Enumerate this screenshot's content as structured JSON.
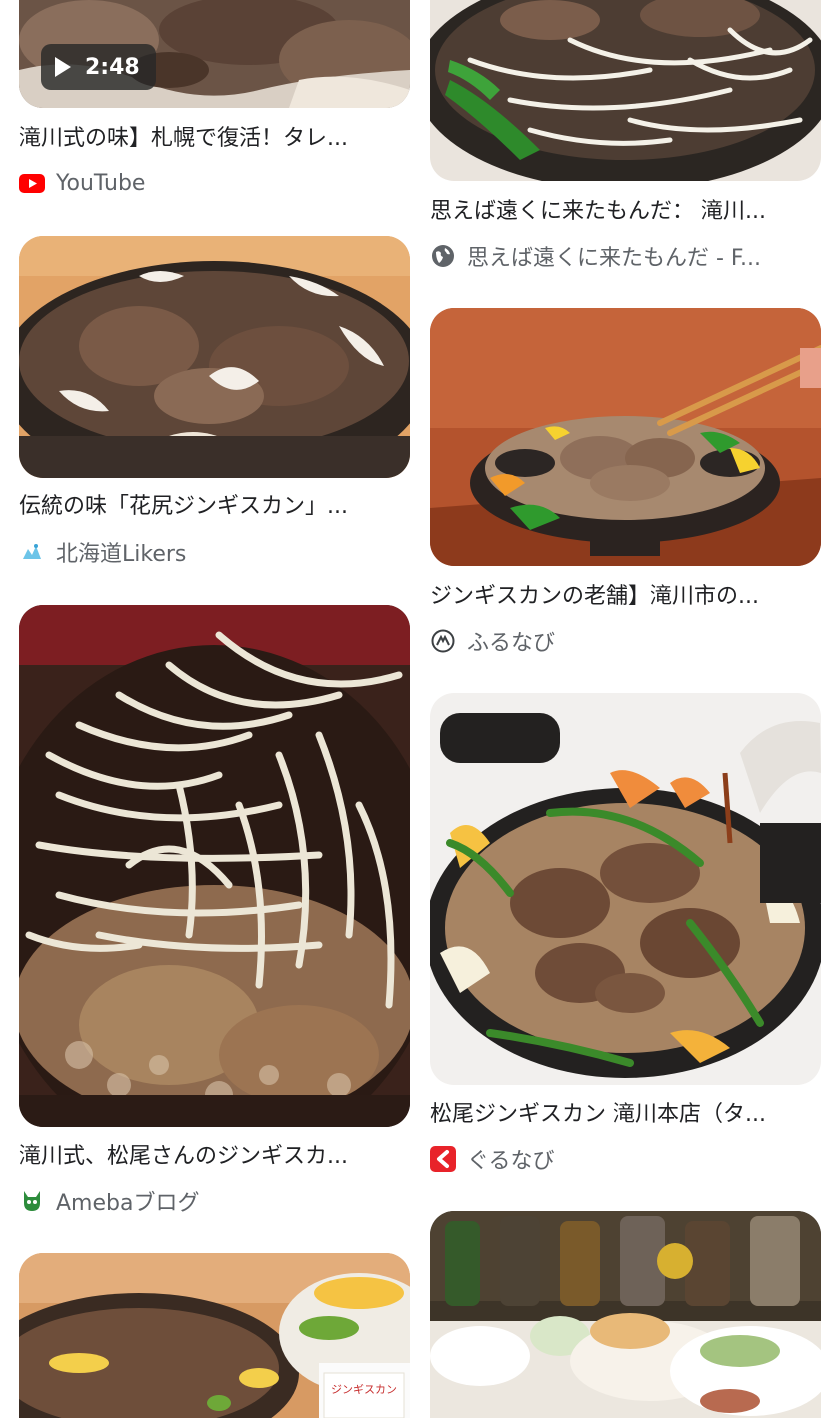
{
  "results": {
    "left": [
      {
        "title": "滝川式の味】札幌で復活！タレ...",
        "source": "YouTube",
        "source_icon": "youtube-icon",
        "video_duration": "2:48"
      },
      {
        "title": "伝統の味「花尻ジンギスカン」...",
        "source": "北海道Likers",
        "source_icon": "hokkaido-likers-icon"
      },
      {
        "title": "滝川式、松尾さんのジンギスカ...",
        "source": "Amebaブログ",
        "source_icon": "ameba-icon"
      },
      {
        "title": "",
        "source": "",
        "source_icon": ""
      }
    ],
    "right": [
      {
        "title": "思えば遠くに来たもんだ： 滝川...",
        "source": "思えば遠くに来たもんだ - F...",
        "source_icon": "globe-icon"
      },
      {
        "title": "ジンギスカンの老舗】滝川市の...",
        "source": "ふるなび",
        "source_icon": "furunavi-icon"
      },
      {
        "title": "松尾ジンギスカン 滝川本店（タ...",
        "source": "ぐるなび",
        "source_icon": "gurunavi-icon"
      },
      {
        "title": "",
        "source": "",
        "source_icon": ""
      }
    ]
  },
  "thumb_image_5_label": "ジンギスカン",
  "colors": {
    "youtube_red": "#ff0000",
    "gurunavi_red": "#e8232a",
    "ameba_green": "#2d8c3c",
    "text_primary": "#202124",
    "text_secondary": "#5f6368"
  }
}
